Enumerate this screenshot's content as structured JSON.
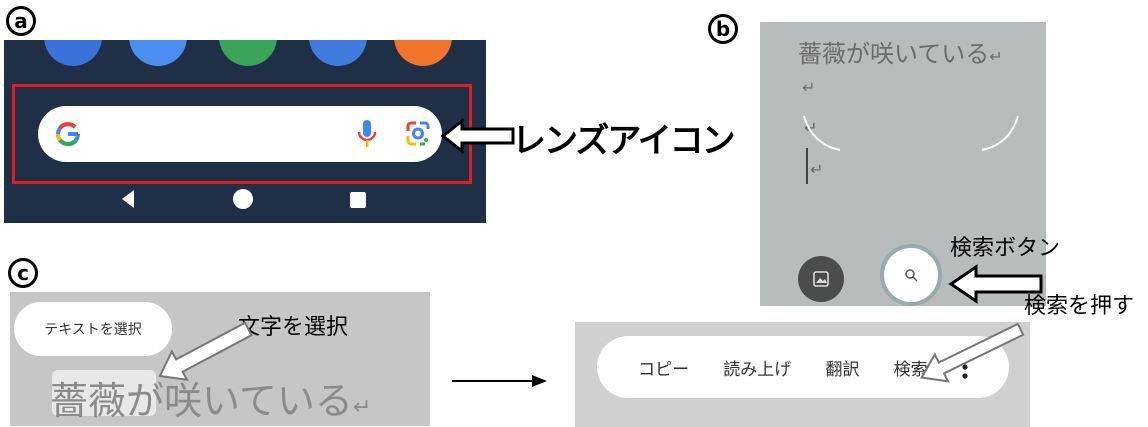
{
  "labels": {
    "a": "a",
    "b": "b",
    "c": "c"
  },
  "panel_a": {
    "annotation": "レンズアイコン",
    "icons": [
      "google-g-icon",
      "mic-icon",
      "lens-icon",
      "back-icon",
      "home-icon",
      "recents-icon"
    ]
  },
  "panel_b": {
    "camera_text": "薔薇が咲いている",
    "return_symbol": "↵",
    "annotation": "検索ボタン"
  },
  "panel_c": {
    "select_text_button": "テキストを選択",
    "selected_text": "薔薇が咲いている",
    "annotation": "文字を選択"
  },
  "panel_d": {
    "menu": [
      "コピー",
      "読み上げ",
      "翻訳",
      "検索"
    ],
    "annotation": "検索を押す"
  },
  "colors": {
    "highlight_box": "#e02020",
    "panel_a_bg": "#1f2f46"
  }
}
